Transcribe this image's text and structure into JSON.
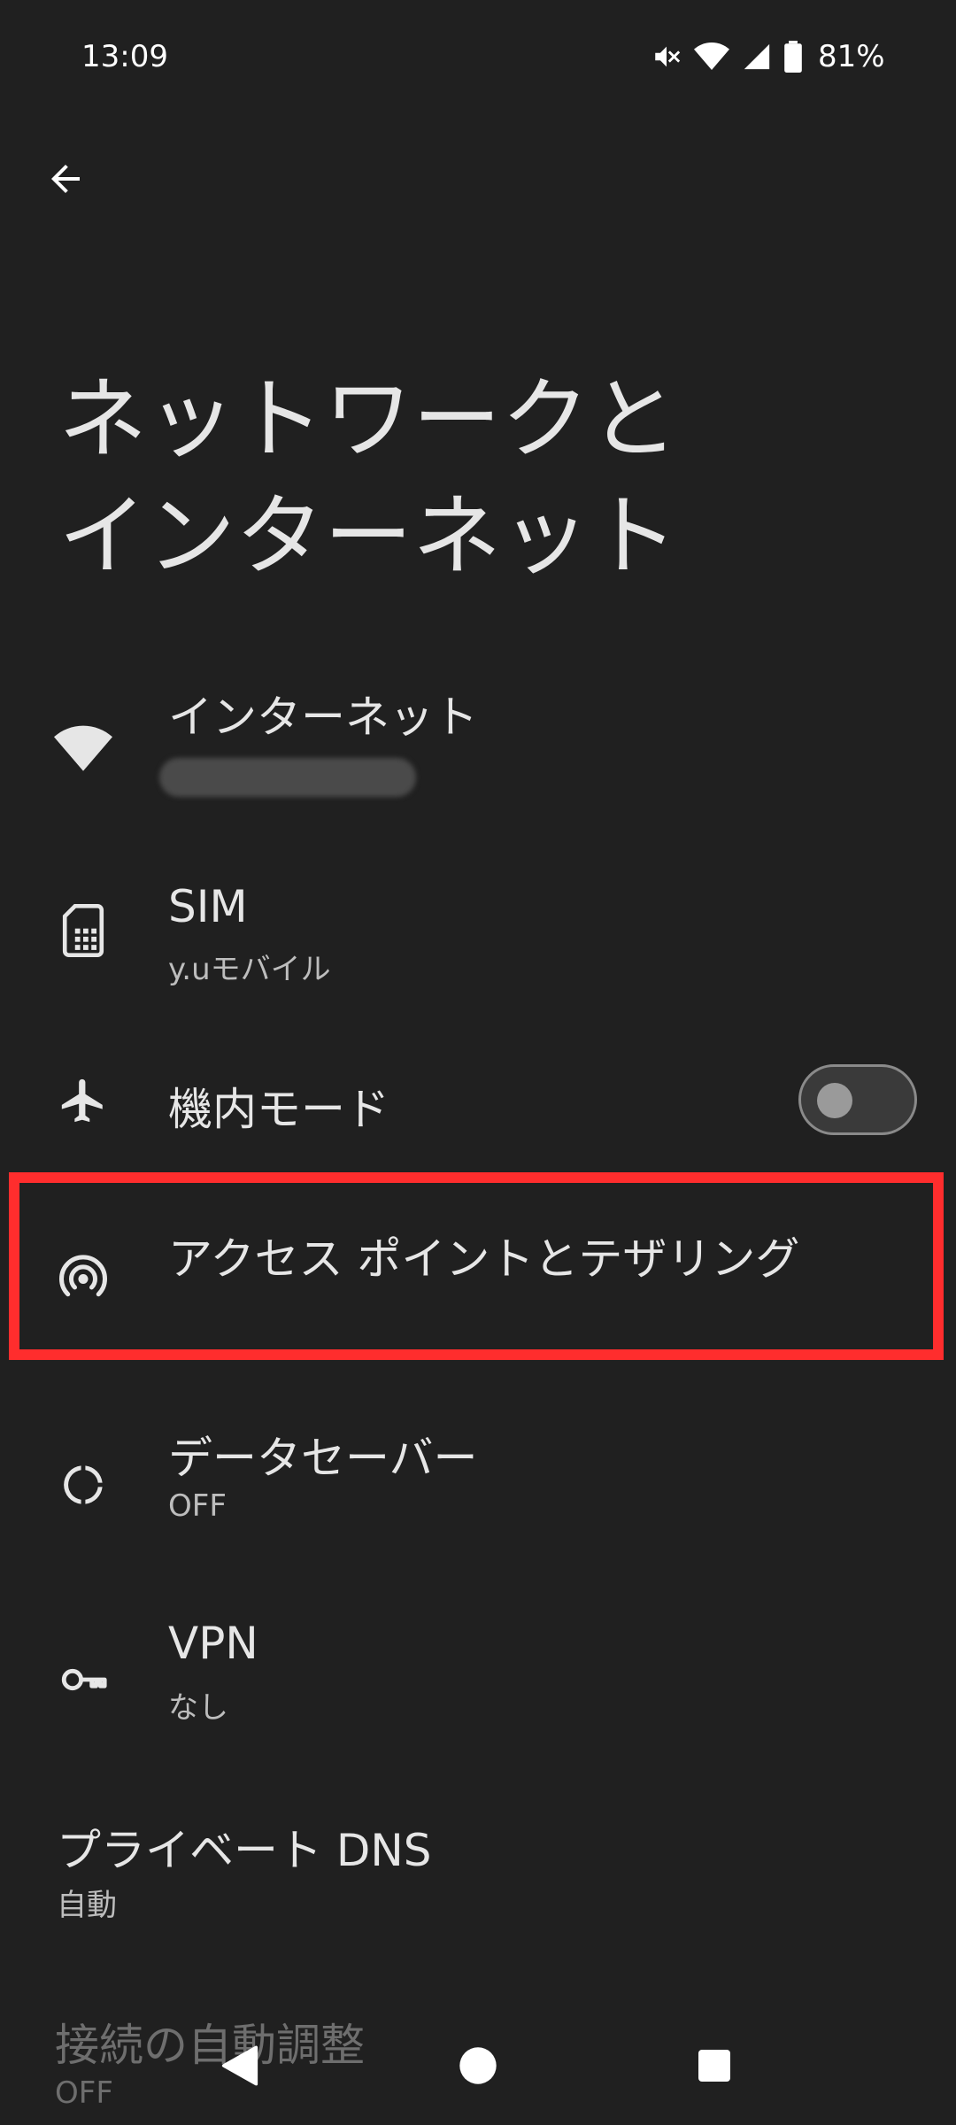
{
  "status_bar": {
    "time": "13:09",
    "battery": "81%",
    "icons": [
      "mute-icon",
      "wifi-icon",
      "signal-icon",
      "battery-icon"
    ]
  },
  "header": {
    "back_icon": "arrow-left-icon",
    "title": "ネットワークと\nインターネット"
  },
  "items": [
    {
      "title": "インターネット",
      "subtitle": "",
      "icon": "wifi-icon"
    },
    {
      "title": "SIM",
      "subtitle": "y.uモバイル",
      "icon": "sim-card-icon"
    },
    {
      "title": "機内モード",
      "subtitle": "",
      "icon": "airplane-icon",
      "toggle": false
    },
    {
      "title": "アクセス ポイントとテザリング",
      "subtitle": "",
      "icon": "hotspot-icon",
      "highlighted": true
    },
    {
      "title": "データセーバー",
      "subtitle": "OFF",
      "icon": "data-saver-icon"
    },
    {
      "title": "VPN",
      "subtitle": "なし",
      "icon": "key-icon"
    },
    {
      "title": "プライベート DNS",
      "subtitle": "自動"
    },
    {
      "title": "接続の自動調整",
      "subtitle": "OFF"
    }
  ],
  "colors": {
    "background": "#202020",
    "highlight": "#ff2d2d",
    "text": "#e6e6e6"
  },
  "nav": {
    "icons": [
      "back-triangle-icon",
      "home-circle-icon",
      "recents-square-icon"
    ]
  }
}
